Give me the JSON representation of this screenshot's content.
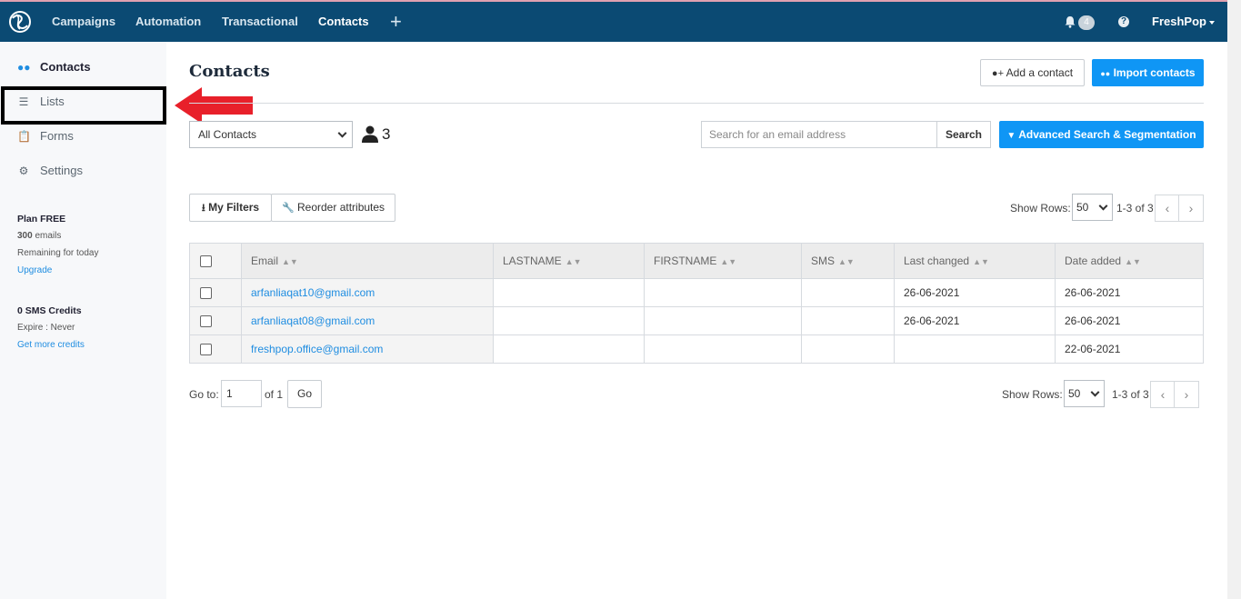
{
  "topbar": {
    "nav": [
      "Campaigns",
      "Automation",
      "Transactional",
      "Contacts"
    ],
    "notifications_count": "4",
    "help_icon": "?",
    "user": "FreshPop"
  },
  "sidebar": {
    "items": [
      {
        "label": "Contacts",
        "icon": "users-icon"
      },
      {
        "label": "Lists",
        "icon": "list-icon"
      },
      {
        "label": "Forms",
        "icon": "clipboard-icon"
      },
      {
        "label": "Settings",
        "icon": "gear-icon"
      }
    ],
    "plan_title": "Plan FREE",
    "emails_count": "300",
    "emails_text": " emails",
    "remaining": "Remaining for today",
    "upgrade": "Upgrade",
    "sms_credits": "0 SMS Credits",
    "expire": "Expire : Never",
    "get_credits": "Get more credits"
  },
  "main": {
    "title": "Contacts",
    "add_contact": "Add a contact",
    "import_contacts": "Import contacts",
    "list_select": "All Contacts",
    "contact_count": "3",
    "search_placeholder": "Search for an email address",
    "search_button": "Search",
    "advanced_search": "Advanced Search & Segmentation",
    "my_filters": "My Filters",
    "reorder_attributes": "Reorder attributes",
    "show_rows_label": "Show Rows:",
    "show_rows_value": "50",
    "range_text": "1-3 of 3",
    "goto_label": "Go to:",
    "goto_value": "1",
    "of_pages": "of 1",
    "go_button": "Go"
  },
  "table": {
    "columns": [
      "Email",
      "LASTNAME",
      "FIRSTNAME",
      "SMS",
      "Last changed",
      "Date added"
    ],
    "rows": [
      {
        "email": "arfanliaqat10@gmail.com",
        "lastname": "",
        "firstname": "",
        "sms": "",
        "last_changed": "26-06-2021",
        "date_added": "26-06-2021"
      },
      {
        "email": "arfanliaqat08@gmail.com",
        "lastname": "",
        "firstname": "",
        "sms": "",
        "last_changed": "26-06-2021",
        "date_added": "26-06-2021"
      },
      {
        "email": "freshpop.office@gmail.com",
        "lastname": "",
        "firstname": "",
        "sms": "",
        "last_changed": "",
        "date_added": "22-06-2021"
      }
    ]
  },
  "colors": {
    "topbar": "#0b4a73",
    "primary": "#0f96f5",
    "link": "#1f8de1",
    "annotation_arrow": "#e8202a"
  }
}
